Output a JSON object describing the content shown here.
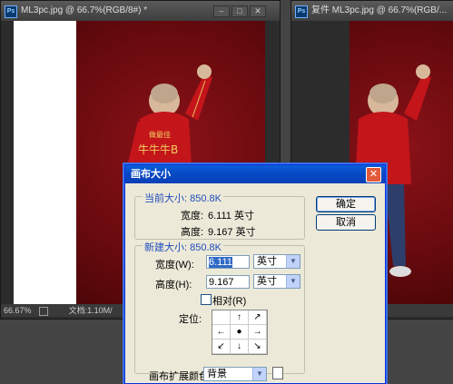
{
  "window_left": {
    "title": "ML3pc.jpg @ 66.7%(RGB/8#) *",
    "ps_icon": "Ps",
    "zoom": "66.67%",
    "doc_info": "文档:1.10M/"
  },
  "window_right": {
    "title": "复件 ML3pc.jpg @ 66.7%(RGB/...",
    "ps_icon": "Ps"
  },
  "artwork": {
    "jacket_text_small": "做最佳",
    "jacket_text_big": "牛牛牛B"
  },
  "dialog": {
    "title": "画布大小",
    "close_label": "✕",
    "current_size": {
      "label": "当前大小: 850.8K",
      "width_label": "宽度:",
      "width_value": "6.111 英寸",
      "height_label": "高度:",
      "height_value": "9.167 英寸"
    },
    "new_size": {
      "label": "新建大小: 850.8K",
      "width_label": "宽度(W):",
      "width_value": "6.111",
      "height_label": "高度(H):",
      "height_value": "9.167",
      "unit_width": "英寸",
      "unit_height": "英寸",
      "relative_label": "相对(R)",
      "anchor_label": "定位:"
    },
    "ok_label": "确定",
    "cancel_label": "取消",
    "ext_color_label": "画布扩展颜色:",
    "ext_color_value": "背景"
  },
  "colors": {
    "canvas_red": "#6a0b0f",
    "dialog_title_blue": "#0648c4",
    "group_label_blue": "#1f4dbe"
  }
}
